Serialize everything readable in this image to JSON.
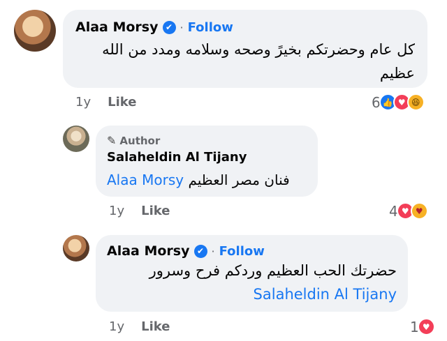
{
  "comments": [
    {
      "author": "Alaa Morsy",
      "verified_mark": "✔",
      "separator": "·",
      "follow_label": "Follow",
      "text": "كل عام وحضرتكم بخيرً وصحه وسلامه ومدد من الله عظيم",
      "time": "1y",
      "like_label": "Like",
      "reaction_count": "6",
      "reaction_icons": [
        "like-icon",
        "love-icon",
        "haha-icon"
      ]
    },
    {
      "badge": "Author",
      "author": "Salaheldin Al Tijany",
      "mention": "Alaa Morsy",
      "text": "فنان مصر العظيم",
      "time": "1y",
      "like_label": "Like",
      "reaction_count": "4",
      "reaction_icons": [
        "love-icon",
        "care-icon"
      ]
    },
    {
      "author": "Alaa Morsy",
      "verified_mark": "✔",
      "separator": "·",
      "follow_label": "Follow",
      "mention": "Salaheldin Al Tijany",
      "text": "حضرتك الحب العظيم وردكم فرح وسرور",
      "time": "1y",
      "like_label": "Like",
      "reaction_count": "1",
      "reaction_icons": [
        "love-icon"
      ]
    }
  ],
  "colors": {
    "accent": "#1877f2",
    "bubble": "#f0f2f5",
    "muted": "#65676b",
    "love": "#f33e58"
  }
}
